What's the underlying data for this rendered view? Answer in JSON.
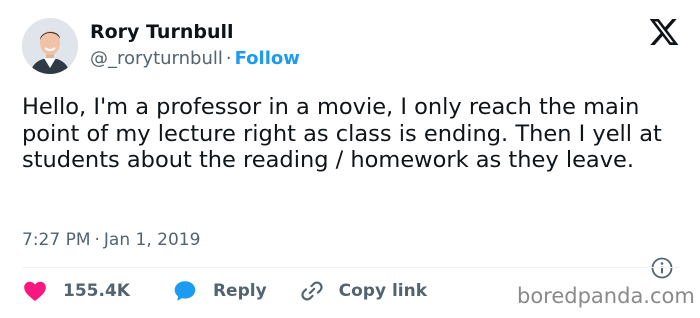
{
  "user": {
    "display_name": "Rory Turnbull",
    "handle": "@_roryturnbull",
    "separator": "·",
    "follow_label": "Follow"
  },
  "tweet": {
    "text": "Hello, I'm a professor in a movie, I only reach the main point of my lecture right as class is ending. Then I yell at students about the reading / homework as they leave.",
    "time": "7:27 PM",
    "date": "Jan 1, 2019"
  },
  "actions": {
    "likes_count": "155.4K",
    "reply_label": "Reply",
    "copy_label": "Copy link"
  },
  "watermark": "boredpanda.com",
  "icons": {
    "brand": "x-logo-icon",
    "like": "heart-icon",
    "reply": "speech-bubble-icon",
    "copy": "link-icon",
    "info": "info-icon"
  },
  "colors": {
    "accent": "#1d9bf0",
    "like": "#f91880",
    "text": "#0f1419",
    "secondary": "#536471"
  }
}
